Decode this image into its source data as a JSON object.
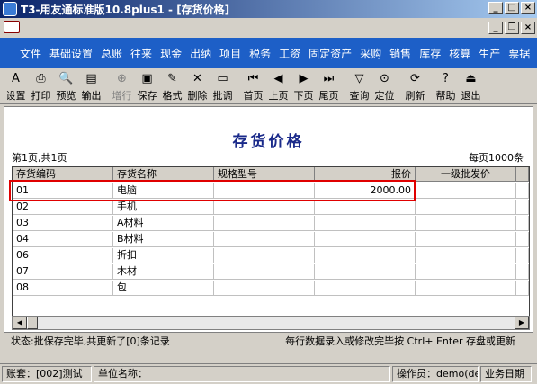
{
  "window": {
    "title": "T3-用友通标准版10.8plus1 - [存货价格]"
  },
  "menu": [
    "文件",
    "基础设置",
    "总账",
    "往来",
    "现金",
    "出纳",
    "项目",
    "税务",
    "工资",
    "固定资产",
    "采购",
    "销售",
    "库存",
    "核算",
    "生产",
    "票据"
  ],
  "toolbar": [
    {
      "label": "设置",
      "icon": "settings-icon",
      "glyph": "A",
      "enabled": true
    },
    {
      "label": "打印",
      "icon": "print-icon",
      "glyph": "⎙",
      "enabled": true
    },
    {
      "label": "预览",
      "icon": "preview-icon",
      "glyph": "🔍",
      "enabled": true
    },
    {
      "label": "输出",
      "icon": "export-icon",
      "glyph": "▤",
      "enabled": true
    },
    {
      "label": "增行",
      "icon": "add-row-icon",
      "glyph": "⊕",
      "enabled": false
    },
    {
      "label": "保存",
      "icon": "save-icon",
      "glyph": "▣",
      "enabled": true
    },
    {
      "label": "格式",
      "icon": "format-icon",
      "glyph": "✎",
      "enabled": true
    },
    {
      "label": "删除",
      "icon": "delete-icon",
      "glyph": "✕",
      "enabled": true
    },
    {
      "label": "批调",
      "icon": "batch-adjust-icon",
      "glyph": "▭",
      "enabled": true
    },
    {
      "label": "首页",
      "icon": "first-page-icon",
      "glyph": "⏮",
      "enabled": true
    },
    {
      "label": "上页",
      "icon": "prev-page-icon",
      "glyph": "◀",
      "enabled": true
    },
    {
      "label": "下页",
      "icon": "next-page-icon",
      "glyph": "▶",
      "enabled": true
    },
    {
      "label": "尾页",
      "icon": "last-page-icon",
      "glyph": "⏭",
      "enabled": true
    },
    {
      "label": "查询",
      "icon": "query-icon",
      "glyph": "▽",
      "enabled": true
    },
    {
      "label": "定位",
      "icon": "locate-icon",
      "glyph": "⊙",
      "enabled": true
    },
    {
      "label": "刷新",
      "icon": "refresh-icon",
      "glyph": "⟳",
      "enabled": true
    },
    {
      "label": "帮助",
      "icon": "help-icon",
      "glyph": "?",
      "enabled": true
    },
    {
      "label": "退出",
      "icon": "exit-icon",
      "glyph": "⏏",
      "enabled": true
    }
  ],
  "sheet": {
    "title": "存货价格",
    "page_info": "第1页,共1页",
    "per_page": "每页1000条",
    "columns": [
      "存货编码",
      "存货名称",
      "规格型号",
      "报价",
      "一级批发价"
    ],
    "rows": [
      [
        "01",
        "电脑",
        "",
        "2000.00",
        ""
      ],
      [
        "02",
        "手机",
        "",
        "",
        ""
      ],
      [
        "03",
        "A材料",
        "",
        "",
        ""
      ],
      [
        "04",
        "B材料",
        "",
        "",
        ""
      ],
      [
        "06",
        "折扣",
        "",
        "",
        ""
      ],
      [
        "07",
        "木材",
        "",
        "",
        ""
      ],
      [
        "08",
        "包",
        "",
        "",
        ""
      ]
    ]
  },
  "status": {
    "left": "状态:批保存完毕,共更新了[0]条记录",
    "right": "每行数据录入或修改完毕按 Ctrl+ Enter 存盘或更新"
  },
  "bottombar": {
    "account": "账套：[002]测试",
    "company": "单位名称：",
    "operator": "操作员：demo(de",
    "bizdate": "业务日期"
  }
}
